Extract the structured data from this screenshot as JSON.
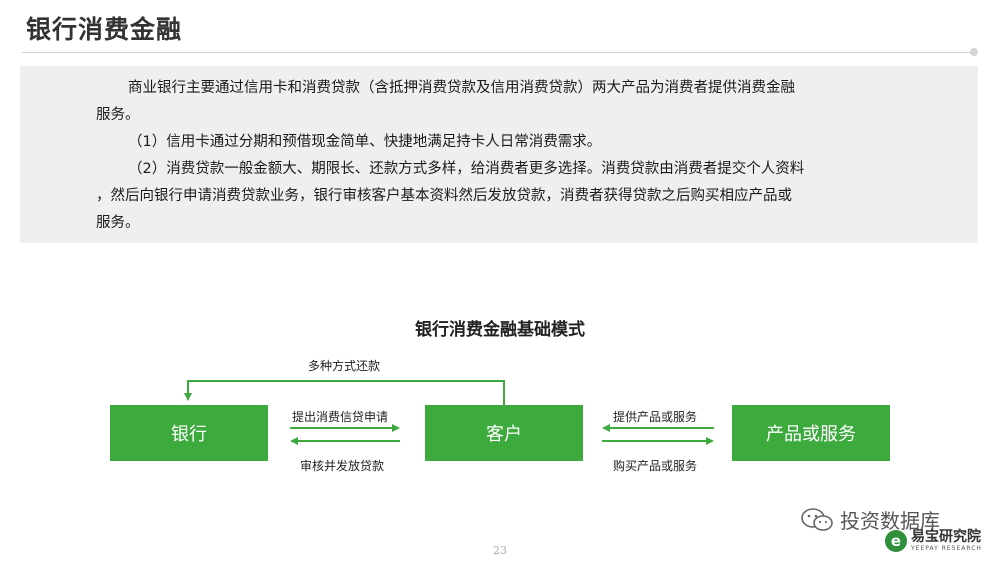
{
  "header": {
    "title": "银行消费金融"
  },
  "text": {
    "p1a": "商业银行主要通过信用卡和消费贷款（含抵押消费贷款及信用消费贷款）两大产品为消费者提供消费金融",
    "p1b": "服务。",
    "p2": "（1）信用卡通过分期和预借现金简单、快捷地满足持卡人日常消费需求。",
    "p3a": "（2）消费贷款一般金额大、期限长、还款方式多样，给消费者更多选择。消费贷款由消费者提交个人资料",
    "p3b": "，然后向银行申请消费贷款业务，银行审核客户基本资料然后发放贷款，消费者获得贷款之后购买相应产品或",
    "p3c": "服务。"
  },
  "diagram": {
    "title": "银行消费金融基础模式",
    "nodes": {
      "bank": "银行",
      "customer": "客户",
      "product": "产品或服务"
    },
    "edges": {
      "repay": "多种方式还款",
      "apply": "提出消费信贷申请",
      "approve": "审核并发放贷款",
      "provide": "提供产品或服务",
      "buy": "购买产品或服务"
    },
    "colors": {
      "node": "#3daa3d",
      "arrow": "#3daa3d"
    }
  },
  "footer": {
    "page_number": "23",
    "watermark_account": "投资数据库",
    "watermark_brand": "易宝研究院",
    "watermark_brand_en": "YEEPAY RESEARCH"
  }
}
